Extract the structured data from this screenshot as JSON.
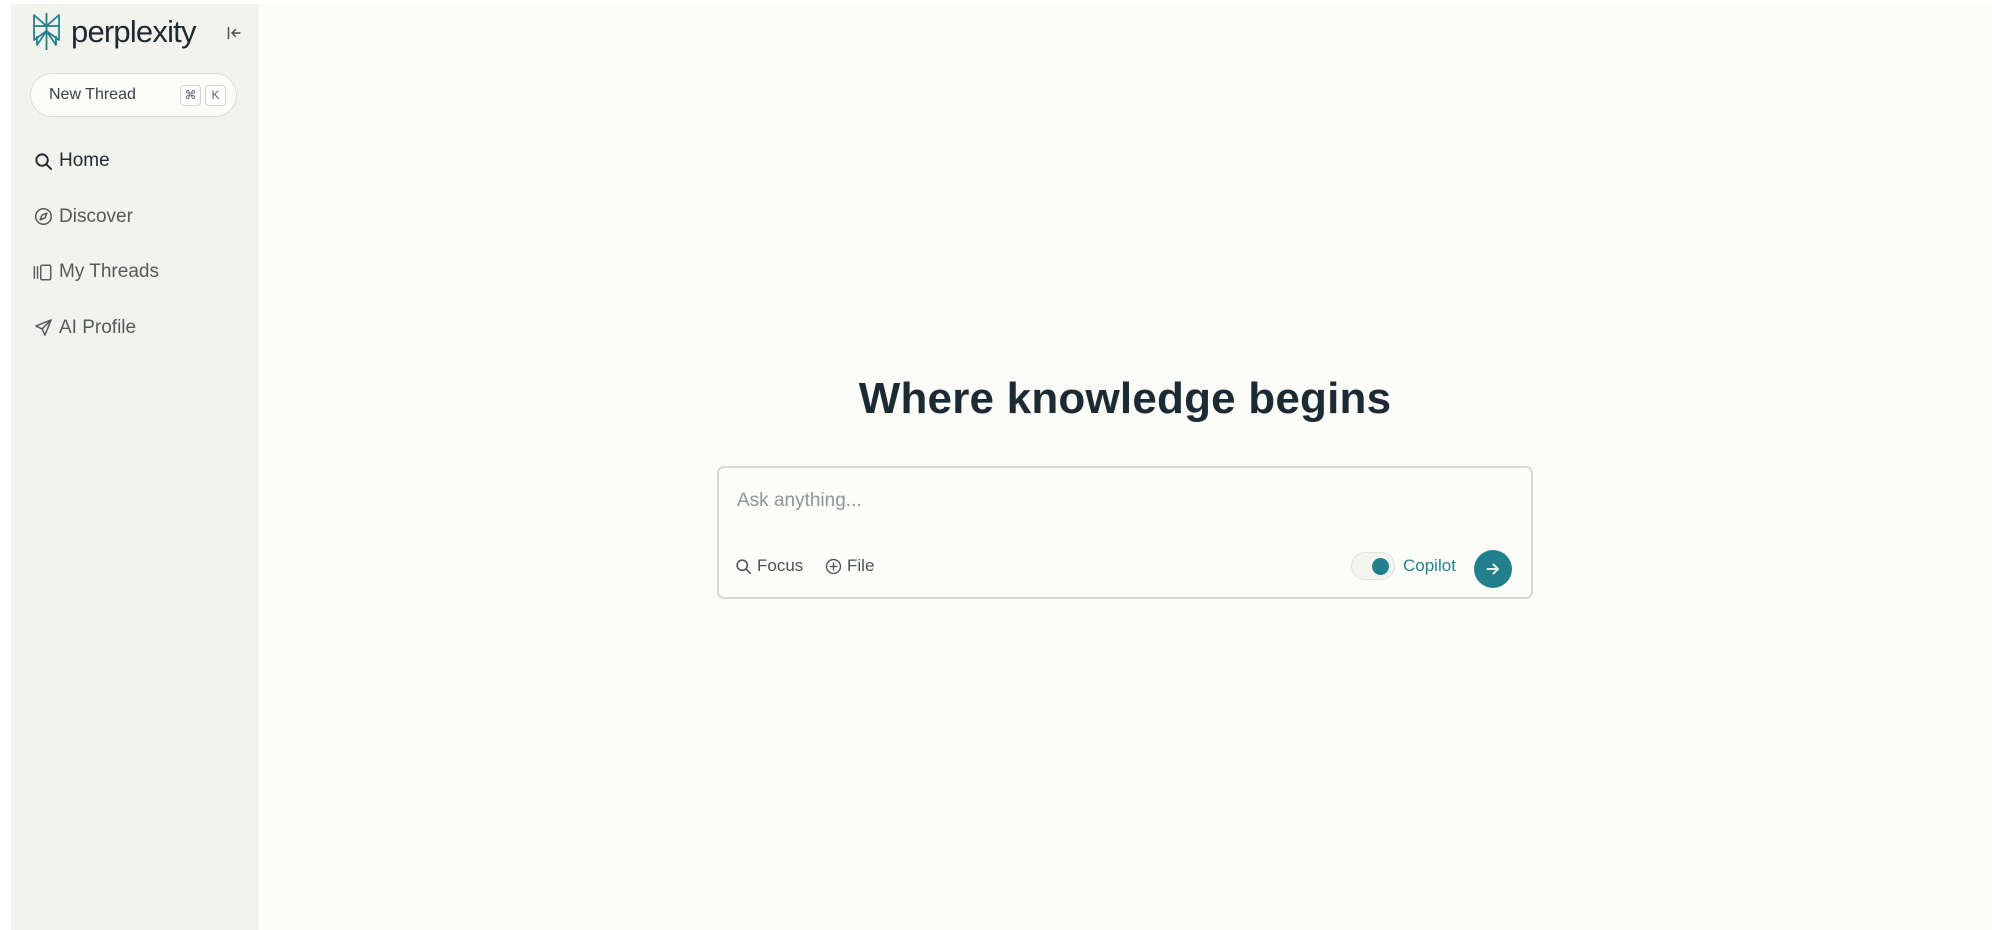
{
  "sidebar": {
    "brand": "perplexity",
    "new_thread": {
      "label": "New Thread",
      "shortcut_keys": [
        "⌘",
        "K"
      ]
    },
    "nav": [
      {
        "label": "Home",
        "icon": "search-icon",
        "active": true
      },
      {
        "label": "Discover",
        "icon": "compass-icon",
        "active": false
      },
      {
        "label": "My Threads",
        "icon": "library-icon",
        "active": false
      },
      {
        "label": "AI Profile",
        "icon": "send-icon",
        "active": false
      }
    ]
  },
  "main": {
    "headline": "Where knowledge begins",
    "search": {
      "placeholder": "Ask anything...",
      "focus_label": "Focus",
      "file_label": "File",
      "copilot_label": "Copilot",
      "copilot_on": true
    }
  },
  "colors": {
    "accent": "#22808d",
    "sidebar_bg": "#f3f3ee",
    "main_bg": "#fbfbf7",
    "text_dark": "#1c2b33"
  }
}
